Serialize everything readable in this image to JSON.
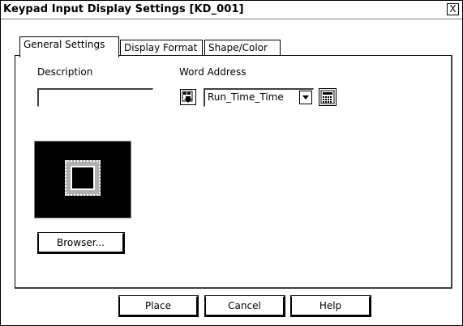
{
  "window": {
    "title": "Keypad Input Display Settings [KD_001]",
    "close_glyph": "X"
  },
  "tabs": [
    {
      "label": "General Settings",
      "active": true
    },
    {
      "label": "Display Format",
      "active": false
    },
    {
      "label": "Shape/Color",
      "active": false
    }
  ],
  "general": {
    "description_label": "Description",
    "description_value": "",
    "word_address_label": "Word Address",
    "word_address_value": "Run_Time_Time"
  },
  "icons": {
    "address_entry": "address-entry-icon",
    "dropdown": "chevron-down-icon",
    "keypad": "keypad-icon"
  },
  "preview": {
    "browser_button": "Browser..."
  },
  "footer": {
    "place": "Place",
    "cancel": "Cancel",
    "help": "Help"
  }
}
